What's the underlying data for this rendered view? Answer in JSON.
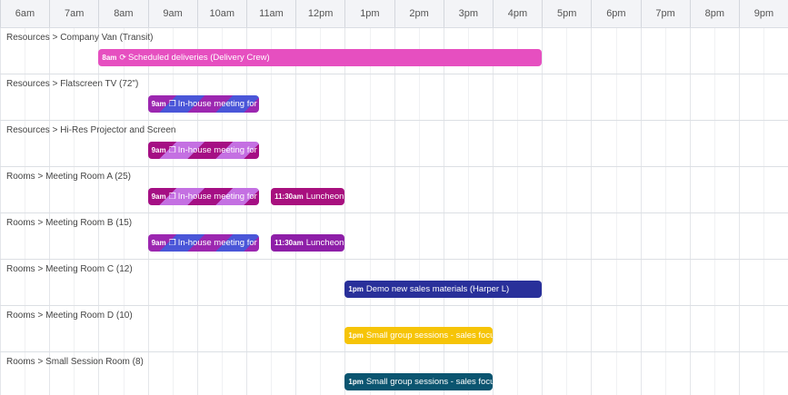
{
  "hours": [
    "6am",
    "7am",
    "8am",
    "9am",
    "10am",
    "11am",
    "12pm",
    "1pm",
    "2pm",
    "3pm",
    "4pm",
    "5pm",
    "6pm",
    "7pm",
    "8pm",
    "9pm"
  ],
  "rows": [
    {
      "label": "Resources > Company Van (Transit)"
    },
    {
      "label": "Resources > Flatscreen TV (72\")"
    },
    {
      "label": "Resources > Hi-Res Projector and Screen"
    },
    {
      "label": "Rooms > Meeting Room A (25)"
    },
    {
      "label": "Rooms > Meeting Room B (15)"
    },
    {
      "label": "Rooms > Meeting Room C (12)"
    },
    {
      "label": "Rooms > Meeting Room D (10)"
    },
    {
      "label": "Rooms > Small Session Room (8)"
    }
  ],
  "events": [
    {
      "row": 0,
      "start": 8,
      "end": 17,
      "time": "8am",
      "icon": "repeat-icon",
      "icon_glyph": "⟳",
      "title": "Scheduled deliveries (Delivery Crew)",
      "color": "#e64fc0",
      "style": "solid"
    },
    {
      "row": 1,
      "start": 9,
      "end": 11.25,
      "time": "9am",
      "icon": "copy-icon",
      "icon_glyph": "❐",
      "title": "In-house meeting for",
      "color": "#9c27b0",
      "style": "stripe-blue"
    },
    {
      "row": 2,
      "start": 9,
      "end": 11.25,
      "time": "9am",
      "icon": "copy-icon",
      "icon_glyph": "❐",
      "title": "In-house meeting for",
      "color": "#a50f84",
      "style": "stripe-pink"
    },
    {
      "row": 3,
      "start": 9,
      "end": 11.25,
      "time": "9am",
      "icon": "copy-icon",
      "icon_glyph": "❐",
      "title": "In-house meeting for",
      "color": "#a50f84",
      "style": "stripe-pink"
    },
    {
      "row": 3,
      "start": 11.5,
      "end": 13,
      "time": "11:30am",
      "icon": "",
      "icon_glyph": "",
      "title": "Luncheon",
      "color": "#a8107e",
      "style": "solid"
    },
    {
      "row": 4,
      "start": 9,
      "end": 11.25,
      "time": "9am",
      "icon": "copy-icon",
      "icon_glyph": "❐",
      "title": "In-house meeting for",
      "color": "#9c27b0",
      "style": "stripe-blue"
    },
    {
      "row": 4,
      "start": 11.5,
      "end": 13,
      "time": "11:30am",
      "icon": "",
      "icon_glyph": "",
      "title": "Luncheon",
      "color": "#8e1fa8",
      "style": "solid"
    },
    {
      "row": 5,
      "start": 13,
      "end": 17,
      "time": "1pm",
      "icon": "",
      "icon_glyph": "",
      "title": "Demo new sales materials (Harper L)",
      "color": "#29309a",
      "style": "solid"
    },
    {
      "row": 6,
      "start": 13,
      "end": 16,
      "time": "1pm",
      "icon": "",
      "icon_glyph": "",
      "title": "Small group sessions - sales focus",
      "color": "#f6c407",
      "style": "solid"
    },
    {
      "row": 7,
      "start": 13,
      "end": 16,
      "time": "1pm",
      "icon": "",
      "icon_glyph": "",
      "title": "Small group sessions - sales focus",
      "color": "#0b5570",
      "style": "solid"
    }
  ]
}
